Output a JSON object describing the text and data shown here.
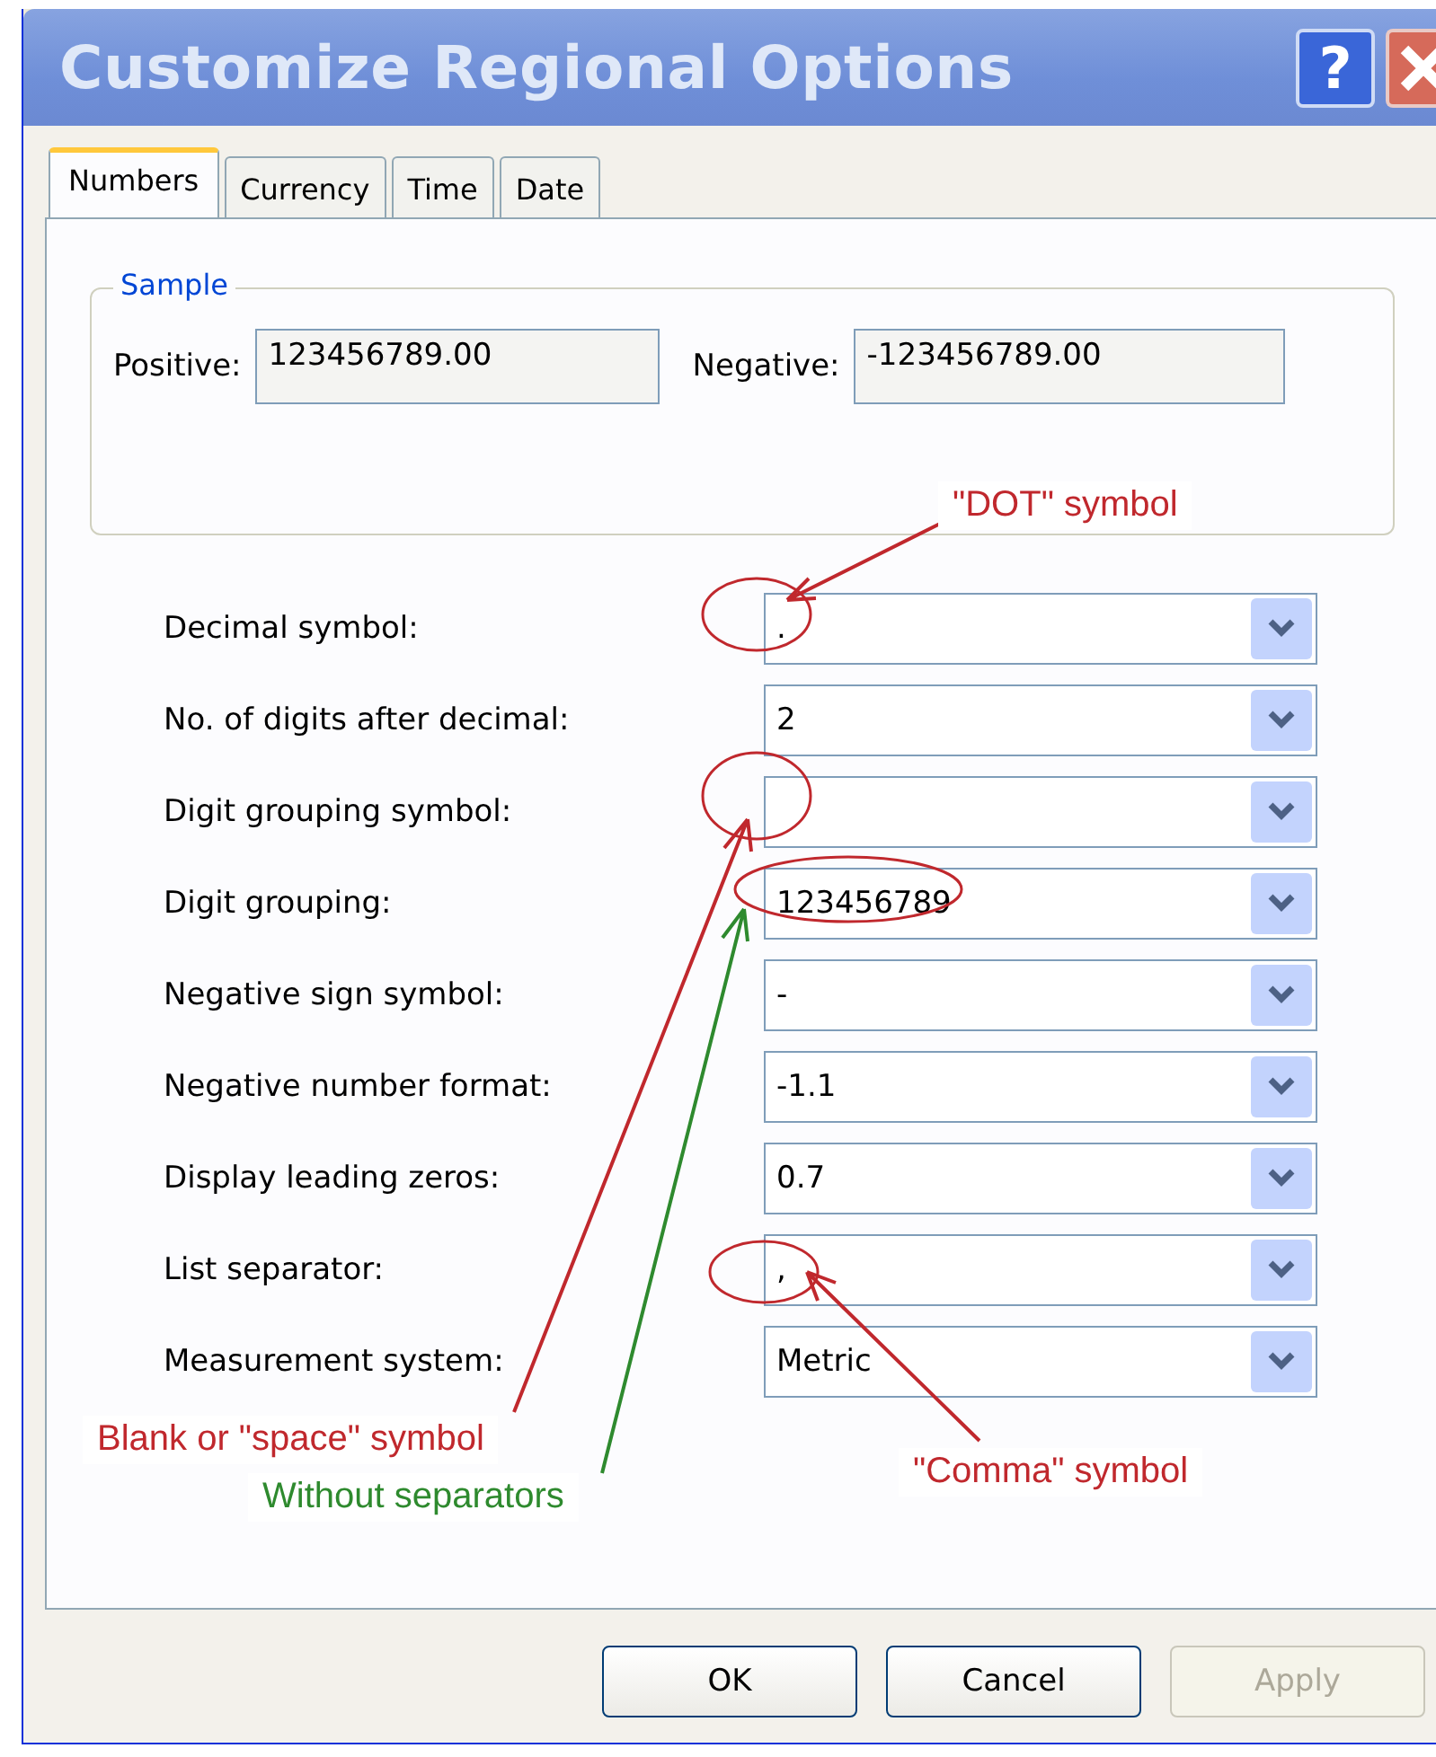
{
  "window": {
    "title": "Customize Regional Options",
    "help_button": "?"
  },
  "tabs": [
    {
      "label": "Numbers",
      "selected": true
    },
    {
      "label": "Currency",
      "selected": false
    },
    {
      "label": "Time",
      "selected": false
    },
    {
      "label": "Date",
      "selected": false
    }
  ],
  "sample": {
    "title": "Sample",
    "fields": [
      {
        "label": "Positive:",
        "value": "123456789.00"
      },
      {
        "label": "Negative:",
        "value": "-123456789.00"
      }
    ]
  },
  "settings": [
    {
      "label": "Decimal symbol:",
      "value": "."
    },
    {
      "label": "No. of digits after decimal:",
      "value": "2"
    },
    {
      "label": "Digit grouping symbol:"
    },
    {
      "label": "Digit grouping:",
      "value": "123456789"
    },
    {
      "label": "Negative sign symbol:",
      "value": "-"
    },
    {
      "label": "Negative number format:",
      "value": "-1.1"
    },
    {
      "label": "Display leading zeros:",
      "value": "0.7"
    },
    {
      "label": "List separator:",
      "value": ","
    },
    {
      "label": "Measurement system:",
      "value": "Metric"
    }
  ],
  "annotations": [
    {
      "text": "\"DOT\" symbol",
      "color": "#c0282d"
    },
    {
      "text": "Blank or \"space\" symbol",
      "color": "#c0282d"
    },
    {
      "text": "Without separators",
      "color": "#2e8a2e"
    },
    {
      "text": "\"Comma\" symbol",
      "color": "#c0282d"
    }
  ],
  "buttons": [
    {
      "label": "OK",
      "disabled": false
    },
    {
      "label": "Cancel",
      "disabled": false
    },
    {
      "label": "Apply",
      "disabled": true
    }
  ]
}
